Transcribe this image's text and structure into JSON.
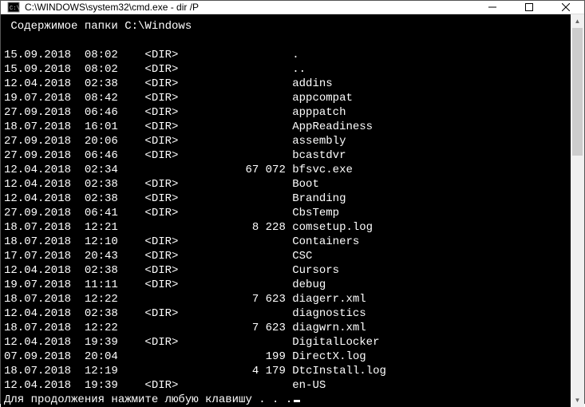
{
  "titlebar": {
    "title": "C:\\WINDOWS\\system32\\cmd.exe - dir  /P"
  },
  "terminal": {
    "header": " Содержимое папки C:\\Windows",
    "rows": [
      {
        "date": "15.09.2018",
        "time": "08:02",
        "dir": "<DIR>",
        "size": "",
        "name": "."
      },
      {
        "date": "15.09.2018",
        "time": "08:02",
        "dir": "<DIR>",
        "size": "",
        "name": ".."
      },
      {
        "date": "12.04.2018",
        "time": "02:38",
        "dir": "<DIR>",
        "size": "",
        "name": "addins"
      },
      {
        "date": "19.07.2018",
        "time": "08:42",
        "dir": "<DIR>",
        "size": "",
        "name": "appcompat"
      },
      {
        "date": "27.09.2018",
        "time": "06:46",
        "dir": "<DIR>",
        "size": "",
        "name": "apppatch"
      },
      {
        "date": "18.07.2018",
        "time": "16:01",
        "dir": "<DIR>",
        "size": "",
        "name": "AppReadiness"
      },
      {
        "date": "27.09.2018",
        "time": "20:06",
        "dir": "<DIR>",
        "size": "",
        "name": "assembly"
      },
      {
        "date": "27.09.2018",
        "time": "06:46",
        "dir": "<DIR>",
        "size": "",
        "name": "bcastdvr"
      },
      {
        "date": "12.04.2018",
        "time": "02:34",
        "dir": "",
        "size": "67 072",
        "name": "bfsvc.exe"
      },
      {
        "date": "12.04.2018",
        "time": "02:38",
        "dir": "<DIR>",
        "size": "",
        "name": "Boot"
      },
      {
        "date": "12.04.2018",
        "time": "02:38",
        "dir": "<DIR>",
        "size": "",
        "name": "Branding"
      },
      {
        "date": "27.09.2018",
        "time": "06:41",
        "dir": "<DIR>",
        "size": "",
        "name": "CbsTemp"
      },
      {
        "date": "18.07.2018",
        "time": "12:21",
        "dir": "",
        "size": "8 228",
        "name": "comsetup.log"
      },
      {
        "date": "18.07.2018",
        "time": "12:10",
        "dir": "<DIR>",
        "size": "",
        "name": "Containers"
      },
      {
        "date": "17.07.2018",
        "time": "20:43",
        "dir": "<DIR>",
        "size": "",
        "name": "CSC"
      },
      {
        "date": "12.04.2018",
        "time": "02:38",
        "dir": "<DIR>",
        "size": "",
        "name": "Cursors"
      },
      {
        "date": "19.07.2018",
        "time": "11:11",
        "dir": "<DIR>",
        "size": "",
        "name": "debug"
      },
      {
        "date": "18.07.2018",
        "time": "12:22",
        "dir": "",
        "size": "7 623",
        "name": "diagerr.xml"
      },
      {
        "date": "12.04.2018",
        "time": "02:38",
        "dir": "<DIR>",
        "size": "",
        "name": "diagnostics"
      },
      {
        "date": "18.07.2018",
        "time": "12:22",
        "dir": "",
        "size": "7 623",
        "name": "diagwrn.xml"
      },
      {
        "date": "12.04.2018",
        "time": "19:39",
        "dir": "<DIR>",
        "size": "",
        "name": "DigitalLocker"
      },
      {
        "date": "07.09.2018",
        "time": "20:04",
        "dir": "",
        "size": "199",
        "name": "DirectX.log"
      },
      {
        "date": "18.07.2018",
        "time": "12:19",
        "dir": "",
        "size": "4 179",
        "name": "DtcInstall.log"
      },
      {
        "date": "12.04.2018",
        "time": "19:39",
        "dir": "<DIR>",
        "size": "",
        "name": "en-US"
      }
    ],
    "prompt": "Для продолжения нажмите любую клавишу . . ."
  }
}
